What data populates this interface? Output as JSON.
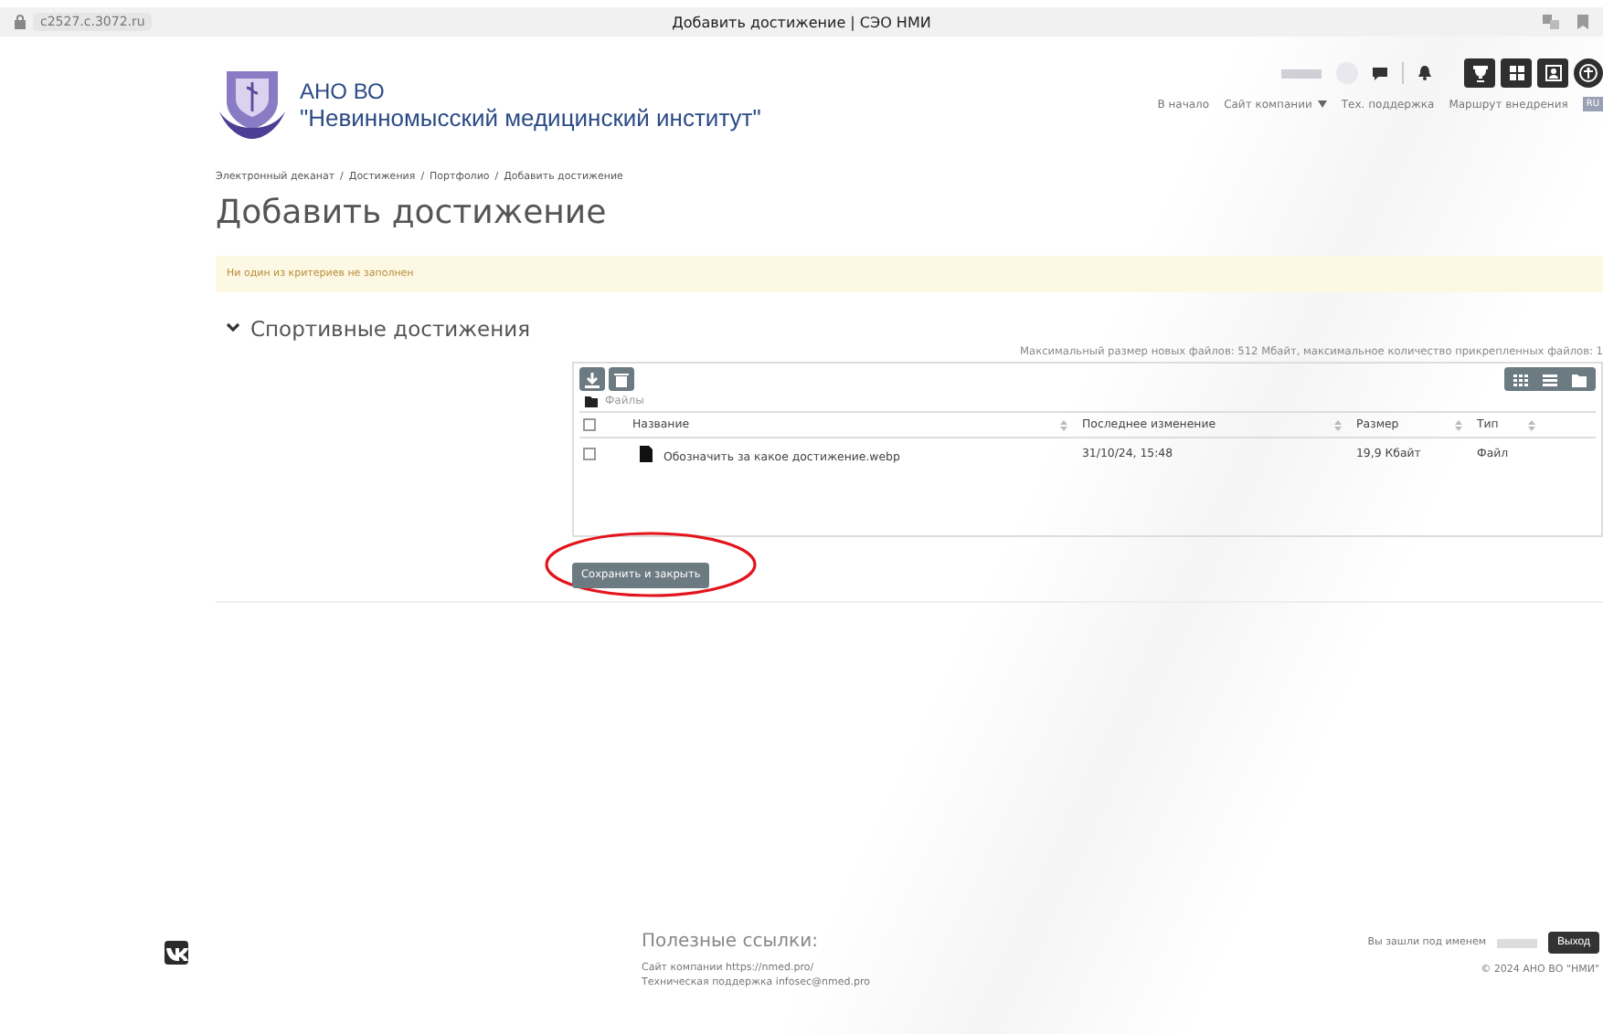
{
  "browser": {
    "address": "c2527.c.3072.ru",
    "title": "Добавить достижение | СЭО НМИ"
  },
  "header": {
    "org": "АНО ВО",
    "institute": "\"Невинномысский медицинский институт\"",
    "languages": [
      {
        "label": "RU",
        "selected": true
      }
    ],
    "nav": [
      {
        "label": "В начало",
        "kind": "link"
      },
      {
        "label": "Сайт компании",
        "kind": "dropdown"
      },
      {
        "label": "Тех. поддержка",
        "kind": "link"
      },
      {
        "label": "Маршрут внедрения",
        "kind": "link"
      }
    ]
  },
  "breadcrumb": {
    "separator": "/",
    "items": [
      "Электронный деканат",
      "Достижения",
      "Портфолио",
      "Добавить достижение"
    ]
  },
  "page_title": "Добавить достижение",
  "alert": "Ни один из критериев не заполнен",
  "section": {
    "title": "Спортивные достижения",
    "expanded": true
  },
  "file_manager": {
    "limits": "Максимальный размер новых файлов: 512 Мбайт, максимальное количество прикрепленных файлов: 1",
    "folder": "Файлы",
    "select_all_checked": false,
    "columns": [
      "Название",
      "Последнее изменение",
      "Размер",
      "Тип"
    ],
    "rows": [
      {
        "name": "Обозначить за какое достижение.webp",
        "modified": "31/10/24, 15:48",
        "size": "19,9 Кбайт",
        "type": "Файл",
        "checked": false
      }
    ]
  },
  "save_button": "Сохранить и закрыть",
  "footer": {
    "links_title": "Полезные ссылки:",
    "links": [
      "Сайт компании https://nmed.pro/",
      "Техническая поддержка infosec@nmed.pro"
    ],
    "logged_in": "Вы зашли под именем",
    "logout": "Выход",
    "copyright": "© 2024 АНО ВО \"НМИ\""
  }
}
